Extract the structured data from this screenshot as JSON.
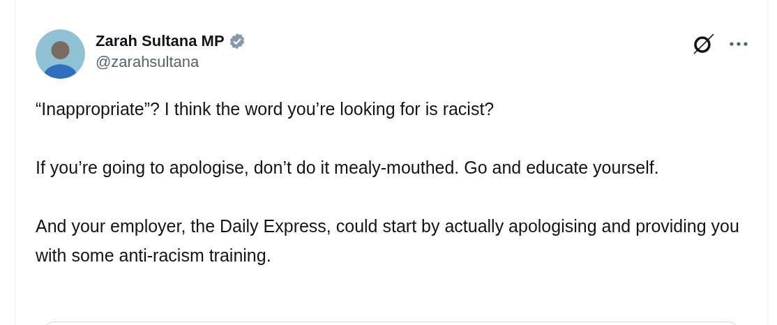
{
  "post": {
    "author": {
      "name": "Zarah Sultana MP",
      "verified": true,
      "handle": "@zarahsultana"
    },
    "paragraphs": [
      "“Inappropriate”? I think the word you’re looking for is racist?",
      "If you’re going to apologise, don’t do it mealy-mouthed. Go and educate yourself.",
      "And your employer, the Daily Express, could start by actually apologising and providing you with some anti-racism training."
    ],
    "quoted_card": {
      "kind": "card"
    }
  }
}
